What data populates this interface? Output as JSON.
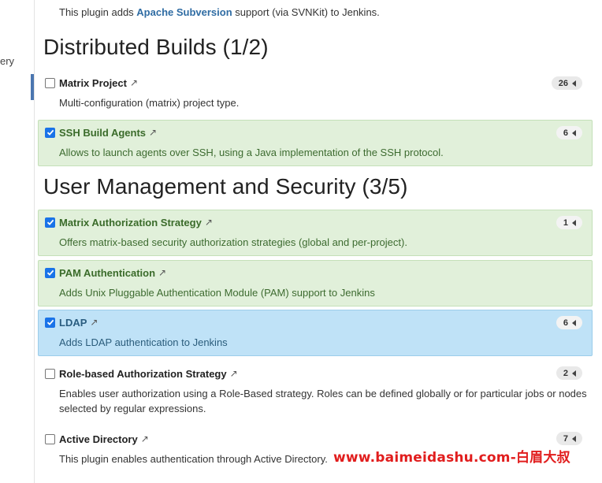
{
  "sidebar": {
    "fragment_text": "ery"
  },
  "intro": {
    "prefix": "This plugin adds ",
    "link": "Apache Subversion",
    "suffix": " support (via SVNKit) to Jenkins."
  },
  "sections": [
    {
      "title": "Distributed Builds (1/2)",
      "plugins": [
        {
          "name": "Matrix Project",
          "checked": false,
          "count": "26",
          "description": "Multi-configuration (matrix) project type."
        },
        {
          "name": "SSH Build Agents",
          "checked": true,
          "count": "6",
          "description": "Allows to launch agents over SSH, using a Java implementation of the SSH protocol."
        }
      ]
    },
    {
      "title": "User Management and Security (3/5)",
      "plugins": [
        {
          "name": "Matrix Authorization Strategy",
          "checked": true,
          "count": "1",
          "description": "Offers matrix-based security authorization strategies (global and per-project)."
        },
        {
          "name": "PAM Authentication",
          "checked": true,
          "count": "6",
          "description": "Adds Unix Pluggable Authentication Module (PAM) support to Jenkins"
        },
        {
          "name": "LDAP",
          "checked": true,
          "count": "6",
          "description": "Adds LDAP authentication to Jenkins"
        },
        {
          "name": "Role-based Authorization Strategy",
          "checked": false,
          "count": "2",
          "description": "Enables user authorization using a Role-Based strategy. Roles can be defined globally or for particular jobs or nodes selected by regular expressions."
        },
        {
          "name": "Active Directory",
          "checked": false,
          "count": "7",
          "description": "This plugin enables authentication through Active Directory."
        }
      ]
    }
  ],
  "external_link_glyph": "↗",
  "watermark": "www.baimeidashu.com-白眉大叔",
  "colors": {
    "selected_bg": "#e1f0da",
    "highlight_bg": "#bfe2f7",
    "checkbox": "#1a73e8",
    "link": "#2f6ca3",
    "watermark": "#e11d1d"
  }
}
